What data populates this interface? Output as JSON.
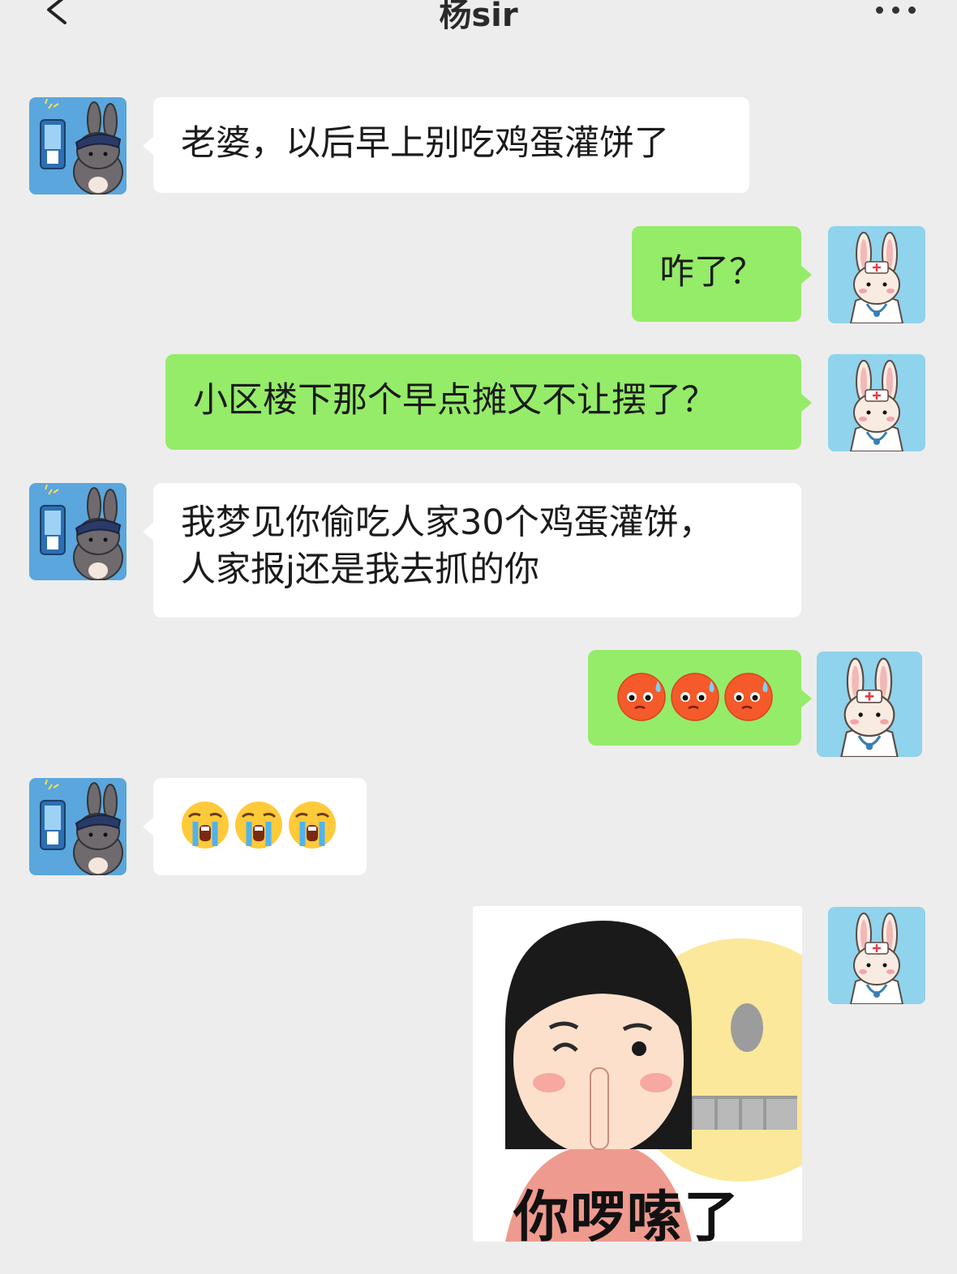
{
  "header": {
    "title": "杨sir",
    "back_icon": "chevron-left-icon",
    "more_icon": "ellipsis-icon"
  },
  "colors": {
    "background": "#ededed",
    "incoming_bubble": "#ffffff",
    "outgoing_bubble": "#95ec69",
    "incoming_avatar_bg": "#5aa6dd",
    "outgoing_avatar_bg": "#8fd3ec"
  },
  "contacts": {
    "incoming_avatar": "police-bunny-avatar",
    "outgoing_avatar": "nurse-bunny-avatar"
  },
  "messages": [
    {
      "side": "in",
      "text": "老婆，以后早上别吃鸡蛋灌饼了"
    },
    {
      "side": "out",
      "text": "咋了？"
    },
    {
      "side": "out",
      "text": "小区楼下那个早点摊又不让摆了？"
    },
    {
      "side": "in",
      "text": "我梦见你偷吃人家30个鸡蛋灌饼，\n人家报j还是我去抓的你"
    },
    {
      "side": "out",
      "emoji": "sweating-face-emoji x3"
    },
    {
      "side": "in",
      "emoji": "loudly-crying-face-emoji x3"
    },
    {
      "side": "out",
      "sticker_caption": "你啰嗦了"
    }
  ]
}
